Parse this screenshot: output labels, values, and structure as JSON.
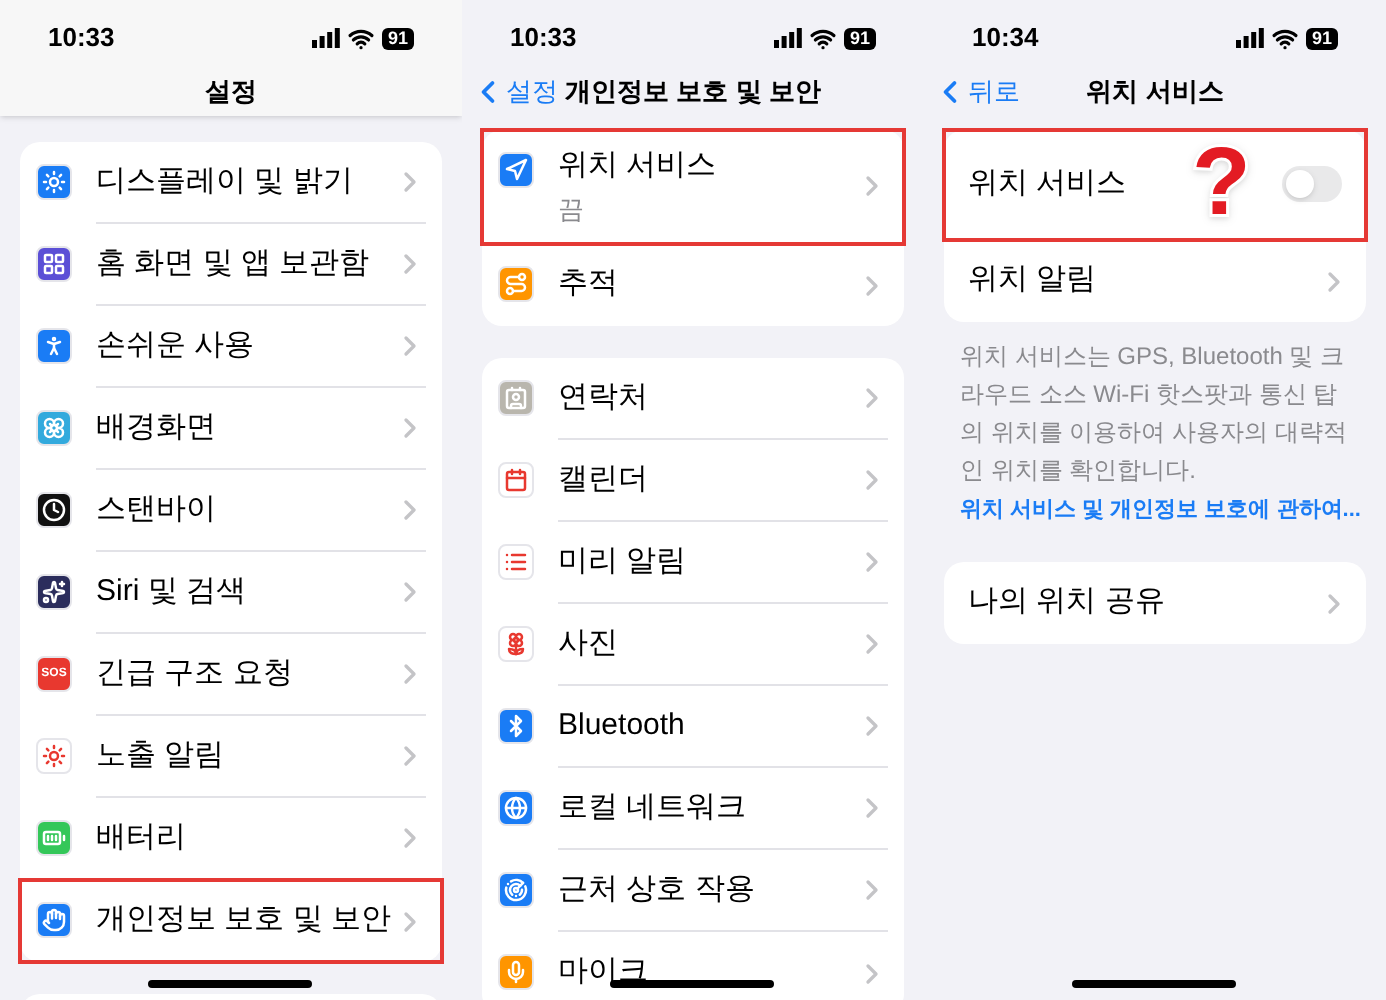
{
  "panels": [
    {
      "status": {
        "time": "10:33",
        "battery": "91"
      },
      "nav": {
        "title": "설정"
      },
      "groups": [
        {
          "rows": [
            {
              "kind": "link",
              "label": "디스플레이 및 밝기",
              "color": "#1a7cf5",
              "highlighted": false
            },
            {
              "kind": "link",
              "label": "홈 화면 및 앱 보관함",
              "color": "#5b4fd6",
              "highlighted": false
            },
            {
              "kind": "link",
              "label": "손쉬운 사용",
              "color": "#1a7cf5",
              "highlighted": false
            },
            {
              "kind": "link",
              "label": "배경화면",
              "color": "#33aadd",
              "highlighted": false
            },
            {
              "kind": "link",
              "label": "스탠바이",
              "color": "#111111",
              "highlighted": false
            },
            {
              "kind": "link",
              "label": "Siri 및 검색",
              "color": "#2b2d5c",
              "highlighted": false
            },
            {
              "kind": "link",
              "label": "긴급 구조 요청",
              "color": "#e8382f",
              "icon_text": "SOS",
              "highlighted": false
            },
            {
              "kind": "link",
              "label": "노출 알림",
              "color": "#ffffff",
              "highlighted": false
            },
            {
              "kind": "link",
              "label": "배터리",
              "color": "#34c759",
              "highlighted": false
            },
            {
              "kind": "link",
              "label": "개인정보 보호 및 보안",
              "color": "#1a7cf5",
              "highlighted": true
            }
          ]
        }
      ]
    },
    {
      "status": {
        "time": "10:33",
        "battery": "91"
      },
      "nav": {
        "back": "설정",
        "title": "개인정보 보호 및 보안"
      },
      "groups": [
        {
          "rows": [
            {
              "kind": "link",
              "label": "위치 서비스",
              "detail": "끔",
              "color": "#1a7cf5",
              "highlighted": true
            },
            {
              "kind": "link",
              "label": "추적",
              "color": "#ff9500",
              "highlighted": false
            }
          ]
        },
        {
          "rows": [
            {
              "kind": "link",
              "label": "연락처",
              "color": "#b9b6ad",
              "highlighted": false
            },
            {
              "kind": "link",
              "label": "캘린더",
              "color": "#ffffff",
              "highlighted": false
            },
            {
              "kind": "link",
              "label": "미리 알림",
              "color": "#ffffff",
              "highlighted": false
            },
            {
              "kind": "link",
              "label": "사진",
              "color": "#ffffff",
              "highlighted": false
            },
            {
              "kind": "link",
              "label": "Bluetooth",
              "color": "#1a7cf5",
              "highlighted": false
            },
            {
              "kind": "link",
              "label": "로컬 네트워크",
              "color": "#1a7cf5",
              "highlighted": false
            },
            {
              "kind": "link",
              "label": "근처 상호 작용",
              "color": "#1a7cf5",
              "highlighted": false
            },
            {
              "kind": "link",
              "label": "마이크",
              "color": "#ff9500",
              "highlighted": false
            }
          ]
        }
      ]
    },
    {
      "status": {
        "time": "10:34",
        "battery": "91"
      },
      "nav": {
        "back": "뒤로",
        "title": "위치 서비스"
      },
      "groups": [
        {
          "rows": [
            {
              "kind": "toggle",
              "label": "위치 서비스",
              "on": false,
              "highlighted": true
            },
            {
              "kind": "link",
              "label": "위치 알림",
              "highlighted": false
            }
          ],
          "footer": {
            "text": "위치 서비스는 GPS, Bluetooth 및 크라우드 소스 Wi-Fi 핫스팟과 통신 탑의 위치를 이용하여 사용자의 대략적인 위치를 확인합니다.",
            "link": "위치 서비스 및 개인정보 보호에 관하여..."
          }
        },
        {
          "rows": [
            {
              "kind": "link",
              "label": "나의 위치 공유",
              "highlighted": false
            }
          ]
        }
      ],
      "annotation": {
        "text": "?"
      }
    }
  ]
}
